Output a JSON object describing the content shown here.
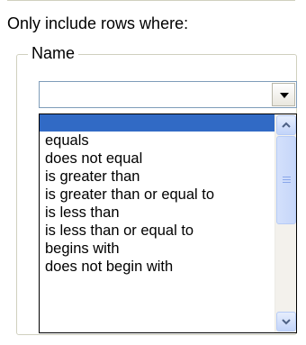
{
  "filter": {
    "heading": "Only include rows where:",
    "group_label": "Name",
    "combo": {
      "value": ""
    },
    "dropdown": {
      "options": [
        "",
        "equals",
        "does not equal",
        "is greater than",
        "is greater than or equal to",
        "is less than",
        "is less than or equal to",
        "begins with",
        "does not begin with"
      ],
      "selected_index": 0
    }
  },
  "colors": {
    "selection": "#316ac5",
    "scrollbar_accent": "#4d6185"
  },
  "icons": {
    "combo_button": "chevron-down-icon",
    "scroll_up": "scroll-up-arrow-icon",
    "scroll_down": "scroll-down-arrow-icon"
  }
}
